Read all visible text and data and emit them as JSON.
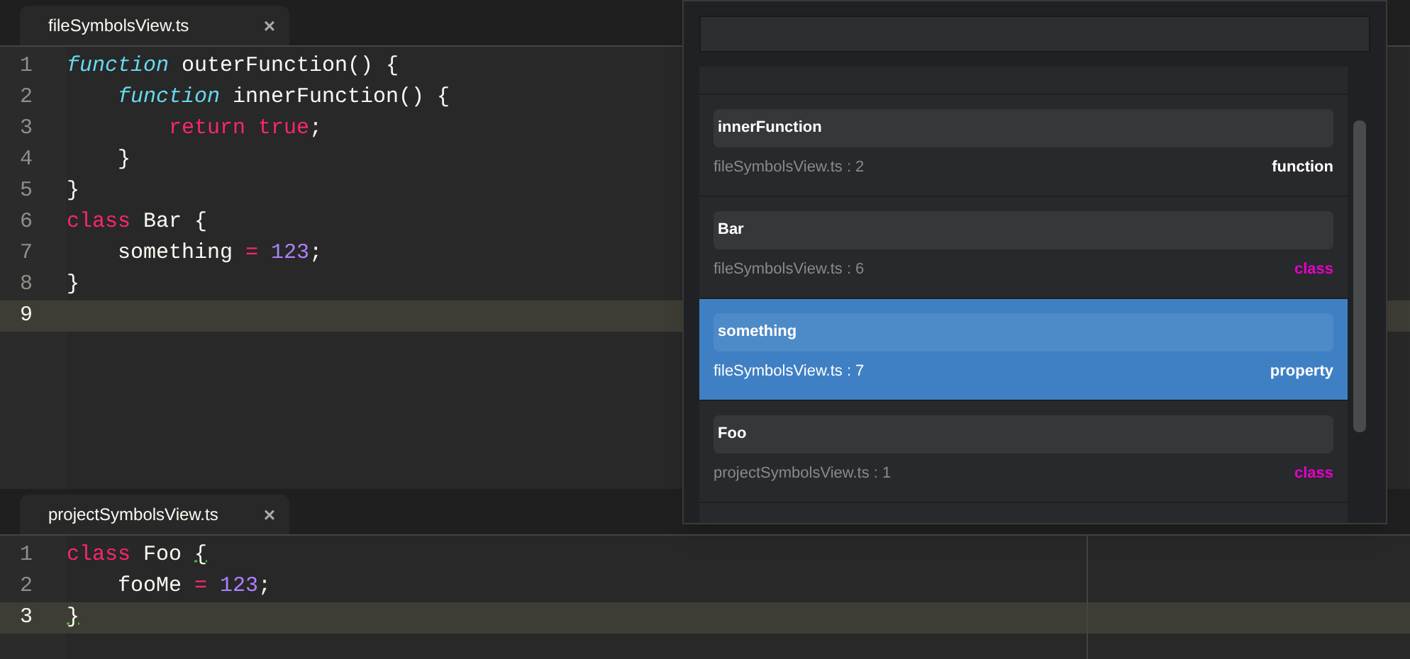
{
  "panes": [
    {
      "tab": {
        "title": "fileSymbolsView.ts",
        "close": "×",
        "selected": true
      },
      "lines": [
        {
          "number": "1",
          "current": false,
          "tokens": [
            {
              "kind": "storage",
              "text": "function"
            },
            {
              "kind": "plain",
              "text": " outerFunction() {"
            }
          ]
        },
        {
          "number": "2",
          "current": false,
          "tokens": [
            {
              "kind": "storage",
              "text": "    function"
            },
            {
              "kind": "plain",
              "text": " innerFunction() {"
            }
          ]
        },
        {
          "number": "3",
          "current": false,
          "tokens": [
            {
              "kind": "keyword",
              "text": "        return"
            },
            {
              "kind": "keyword",
              "text": " true"
            },
            {
              "kind": "plain",
              "text": ";"
            }
          ]
        },
        {
          "number": "4",
          "current": false,
          "tokens": [
            {
              "kind": "plain",
              "text": "    }"
            }
          ]
        },
        {
          "number": "5",
          "current": false,
          "tokens": [
            {
              "kind": "plain",
              "text": "}"
            }
          ]
        },
        {
          "number": "6",
          "current": false,
          "tokens": [
            {
              "kind": "keyword",
              "text": "class"
            },
            {
              "kind": "plain",
              "text": " Bar {"
            }
          ]
        },
        {
          "number": "7",
          "current": false,
          "tokens": [
            {
              "kind": "plain",
              "text": "    something "
            },
            {
              "kind": "keyword",
              "text": "="
            },
            {
              "kind": "number",
              "text": " 123"
            },
            {
              "kind": "plain",
              "text": ";"
            }
          ]
        },
        {
          "number": "8",
          "current": false,
          "tokens": [
            {
              "kind": "plain",
              "text": "}"
            }
          ]
        },
        {
          "number": "9",
          "current": true
        }
      ]
    },
    {
      "tab": {
        "title": "projectSymbolsView.ts",
        "close": "×",
        "selected": true
      },
      "lines": [
        {
          "number": "1",
          "current": false,
          "tokens": [
            {
              "kind": "keyword",
              "text": "class"
            },
            {
              "kind": "plain",
              "text": " Foo "
            },
            {
              "kind": "bracket",
              "text": "{"
            }
          ]
        },
        {
          "number": "2",
          "current": false,
          "tokens": [
            {
              "kind": "plain",
              "text": "    fooMe "
            },
            {
              "kind": "keyword",
              "text": "="
            },
            {
              "kind": "number",
              "text": " 123"
            },
            {
              "kind": "plain",
              "text": ";"
            }
          ]
        },
        {
          "number": "3",
          "current": true,
          "tokens": [
            {
              "kind": "bracket",
              "text": "}"
            }
          ]
        }
      ]
    }
  ],
  "symbol_list": {
    "items": [
      {
        "name": "innerFunction",
        "location": "fileSymbolsView.ts : 2",
        "type": "function",
        "color": "#ffffff",
        "selected": false
      },
      {
        "name": "Bar",
        "location": "fileSymbolsView.ts : 6",
        "type": "class",
        "color": "#e600c8",
        "selected": false
      },
      {
        "name": "something",
        "location": "fileSymbolsView.ts : 7",
        "type": "property",
        "color": "#ffffff",
        "selected": true
      },
      {
        "name": "Foo",
        "location": "projectSymbolsView.ts : 1",
        "type": "class",
        "color": "#e600c8",
        "selected": false
      }
    ]
  }
}
